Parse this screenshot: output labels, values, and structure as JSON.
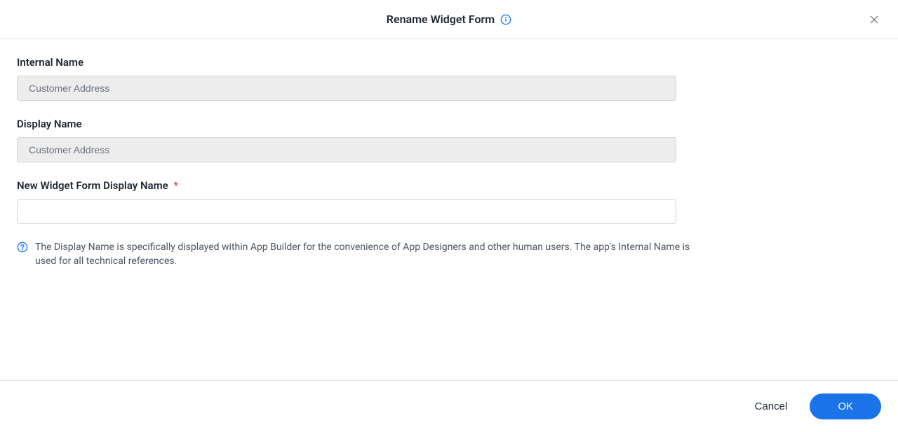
{
  "header": {
    "title": "Rename Widget Form"
  },
  "form": {
    "internal_name": {
      "label": "Internal Name",
      "value": "Customer Address"
    },
    "display_name": {
      "label": "Display Name",
      "value": "Customer Address"
    },
    "new_display_name": {
      "label": "New Widget Form Display Name",
      "required_mark": "*",
      "value": ""
    },
    "help_text": "The Display Name is specifically displayed within App Builder for the convenience of App Designers and other human users. The app's Internal Name is used for all technical references."
  },
  "footer": {
    "cancel_label": "Cancel",
    "ok_label": "OK"
  }
}
